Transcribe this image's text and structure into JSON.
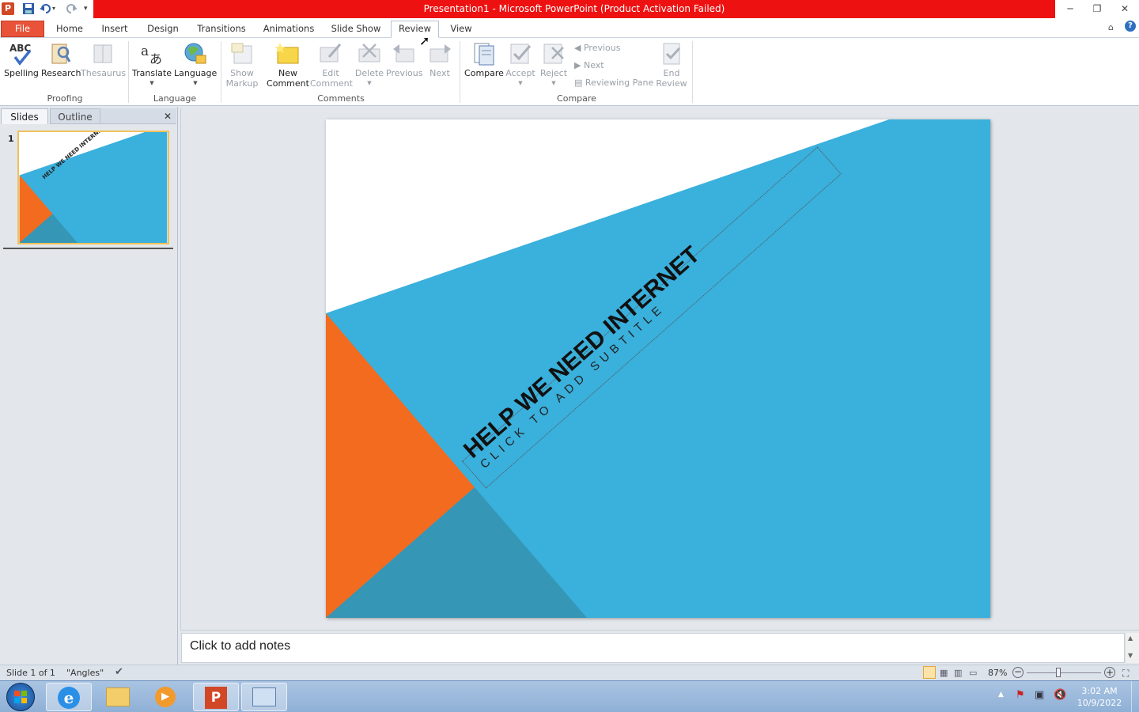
{
  "window": {
    "title": "Presentation1  -  Microsoft PowerPoint (Product Activation Failed)",
    "controls": {
      "minimize": "─",
      "restore": "❐",
      "close": "✕"
    }
  },
  "tabs": [
    "File",
    "Home",
    "Insert",
    "Design",
    "Transitions",
    "Animations",
    "Slide Show",
    "Review",
    "View"
  ],
  "active_tab": "Review",
  "ribbon": {
    "proofing": {
      "spelling": "Spelling",
      "research": "Research",
      "thesaurus": "Thesaurus",
      "group": "Proofing"
    },
    "language": {
      "translate": "Translate",
      "language": "Language",
      "group": "Language"
    },
    "comments": {
      "show_markup_1": "Show",
      "show_markup_2": "Markup",
      "new_comment_1": "New",
      "new_comment_2": "Comment",
      "edit_comment_1": "Edit",
      "edit_comment_2": "Comment",
      "delete": "Delete",
      "previous": "Previous",
      "next": "Next",
      "group": "Comments"
    },
    "compare": {
      "compare": "Compare",
      "accept": "Accept",
      "reject": "Reject",
      "previous": "Previous",
      "next": "Next",
      "reviewing_pane": "Reviewing Pane",
      "end_review_1": "End",
      "end_review_2": "Review",
      "group": "Compare"
    }
  },
  "left_panel": {
    "tab_slides": "Slides",
    "tab_outline": "Outline",
    "slide_number": "1",
    "thumb_title": "HELP WE NEED  INTERNET"
  },
  "slide": {
    "title": "HELP WE NEED INTERNET",
    "subtitle": "CLICK TO ADD SUBTITLE",
    "colors": {
      "blue": "#3ab0dc",
      "orange": "#f26b1f",
      "dark_blue": "#3596b5"
    }
  },
  "notes_placeholder": "Click to add notes",
  "status": {
    "slide_info": "Slide 1 of 1",
    "theme": "\"Angles\"",
    "zoom": "87%"
  },
  "clock": {
    "time": "3:02 AM",
    "date": "10/9/2022"
  }
}
